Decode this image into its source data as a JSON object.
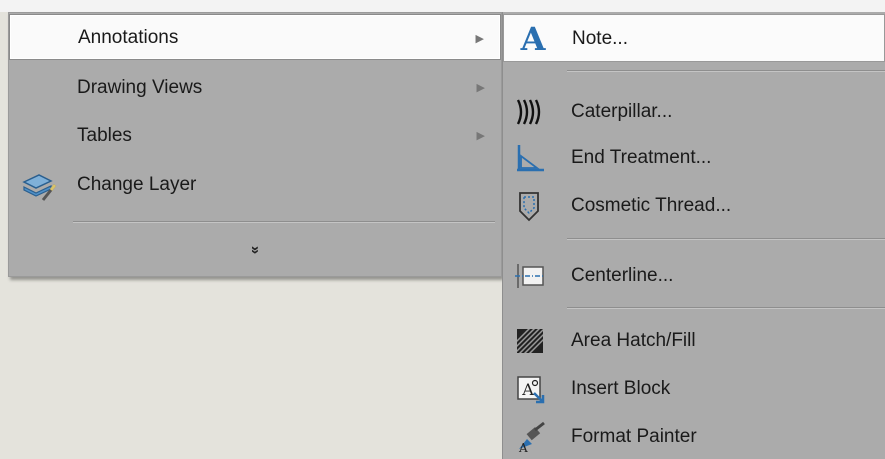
{
  "left_menu": {
    "items": [
      {
        "label": "Annotations",
        "icon": "none",
        "has_submenu": true,
        "selected": true
      },
      {
        "label": "Drawing Views",
        "icon": "none",
        "has_submenu": true,
        "selected": false
      },
      {
        "label": "Tables",
        "icon": "none",
        "has_submenu": true,
        "selected": false
      },
      {
        "label": "Change Layer",
        "icon": "change-layer-icon",
        "has_submenu": false,
        "selected": false
      }
    ],
    "submenu_arrow": "▶",
    "expand_glyph": "»"
  },
  "submenu": {
    "items": [
      {
        "label": "Note...",
        "icon": "note-icon",
        "selected": true
      },
      {
        "label": "Caterpillar...",
        "icon": "caterpillar-icon"
      },
      {
        "label": "End Treatment...",
        "icon": "end-treatment-icon"
      },
      {
        "label": "Cosmetic Thread...",
        "icon": "cosmetic-thread-icon"
      },
      {
        "label": "Centerline...",
        "icon": "centerline-icon"
      },
      {
        "label": "Area Hatch/Fill",
        "icon": "area-hatch-icon"
      },
      {
        "label": "Insert Block",
        "icon": "insert-block-icon"
      },
      {
        "label": "Format Painter",
        "icon": "format-painter-icon"
      }
    ]
  },
  "colors": {
    "menu_background": "#ababab",
    "selected_background": "#fafafa",
    "desktop_background": "#e4e3dc",
    "icon_blue": "#2a6fb0"
  }
}
